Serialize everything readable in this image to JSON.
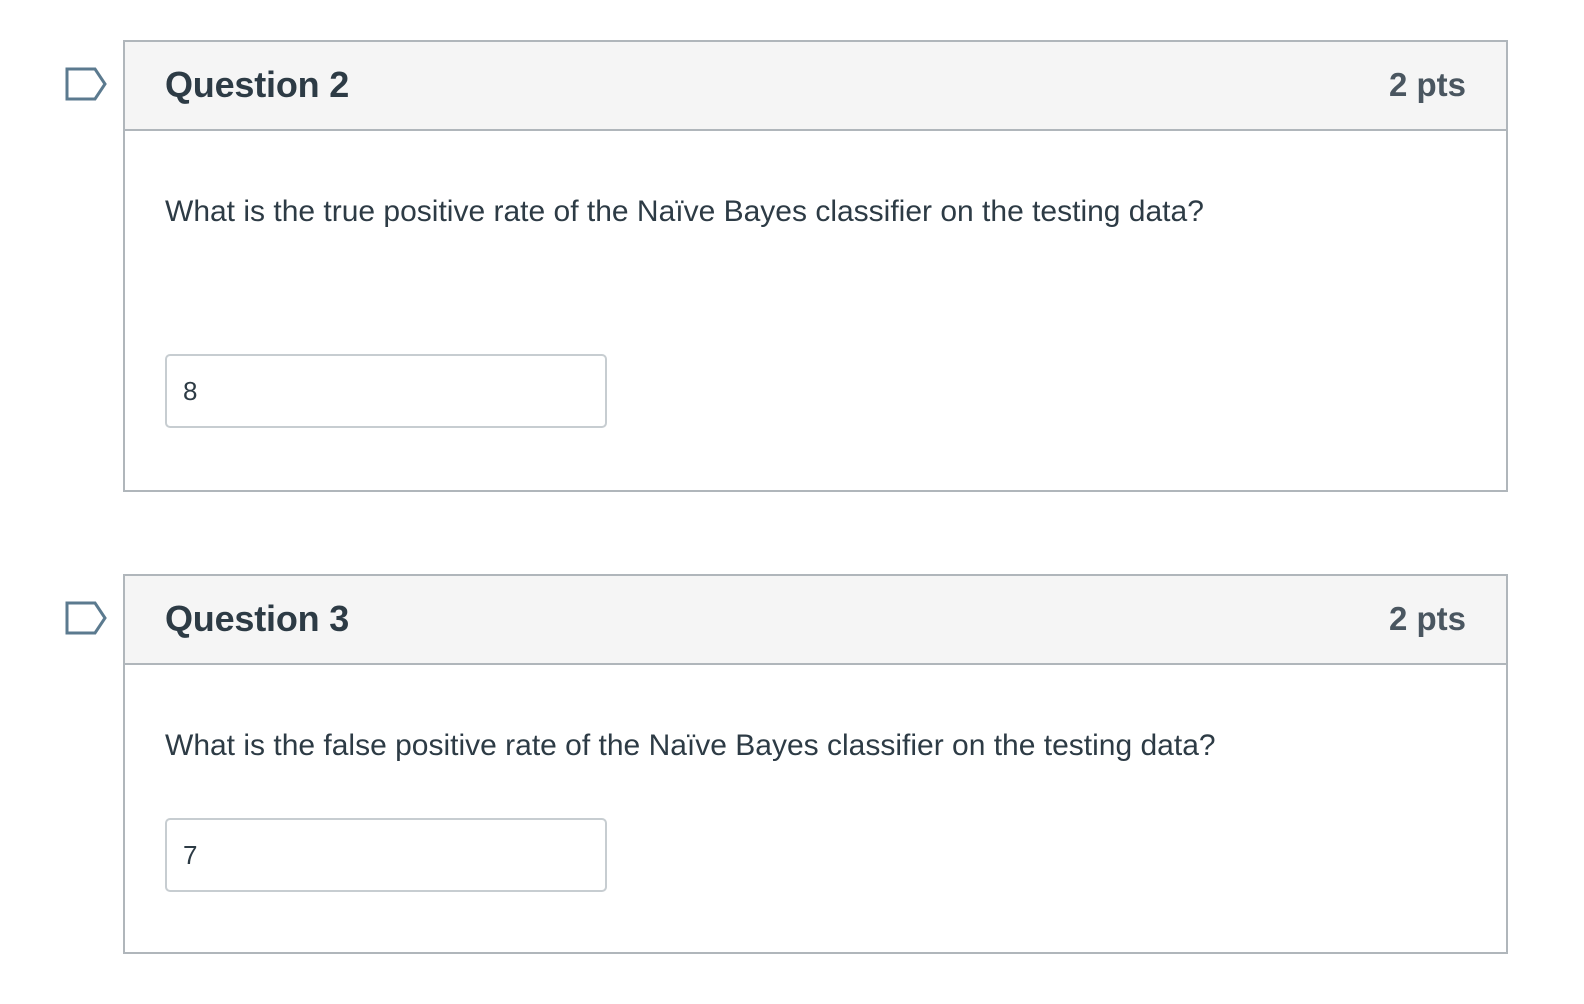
{
  "questions": [
    {
      "title": "Question 2",
      "points": "2 pts",
      "text": "What is the true positive rate of the Naïve Bayes classifier on the testing data?",
      "answer_value": "8",
      "flag_icon": "flag-outline-icon"
    },
    {
      "title": "Question 3",
      "points": "2 pts",
      "text": "What is the false positive rate of the Naïve Bayes classifier on the testing data?",
      "answer_value": "7",
      "flag_icon": "flag-outline-icon"
    }
  ],
  "colors": {
    "border": "#b0b6bb",
    "header_bg": "#f5f5f5",
    "text": "#2d3b45",
    "flag": "#5b7a8f"
  }
}
